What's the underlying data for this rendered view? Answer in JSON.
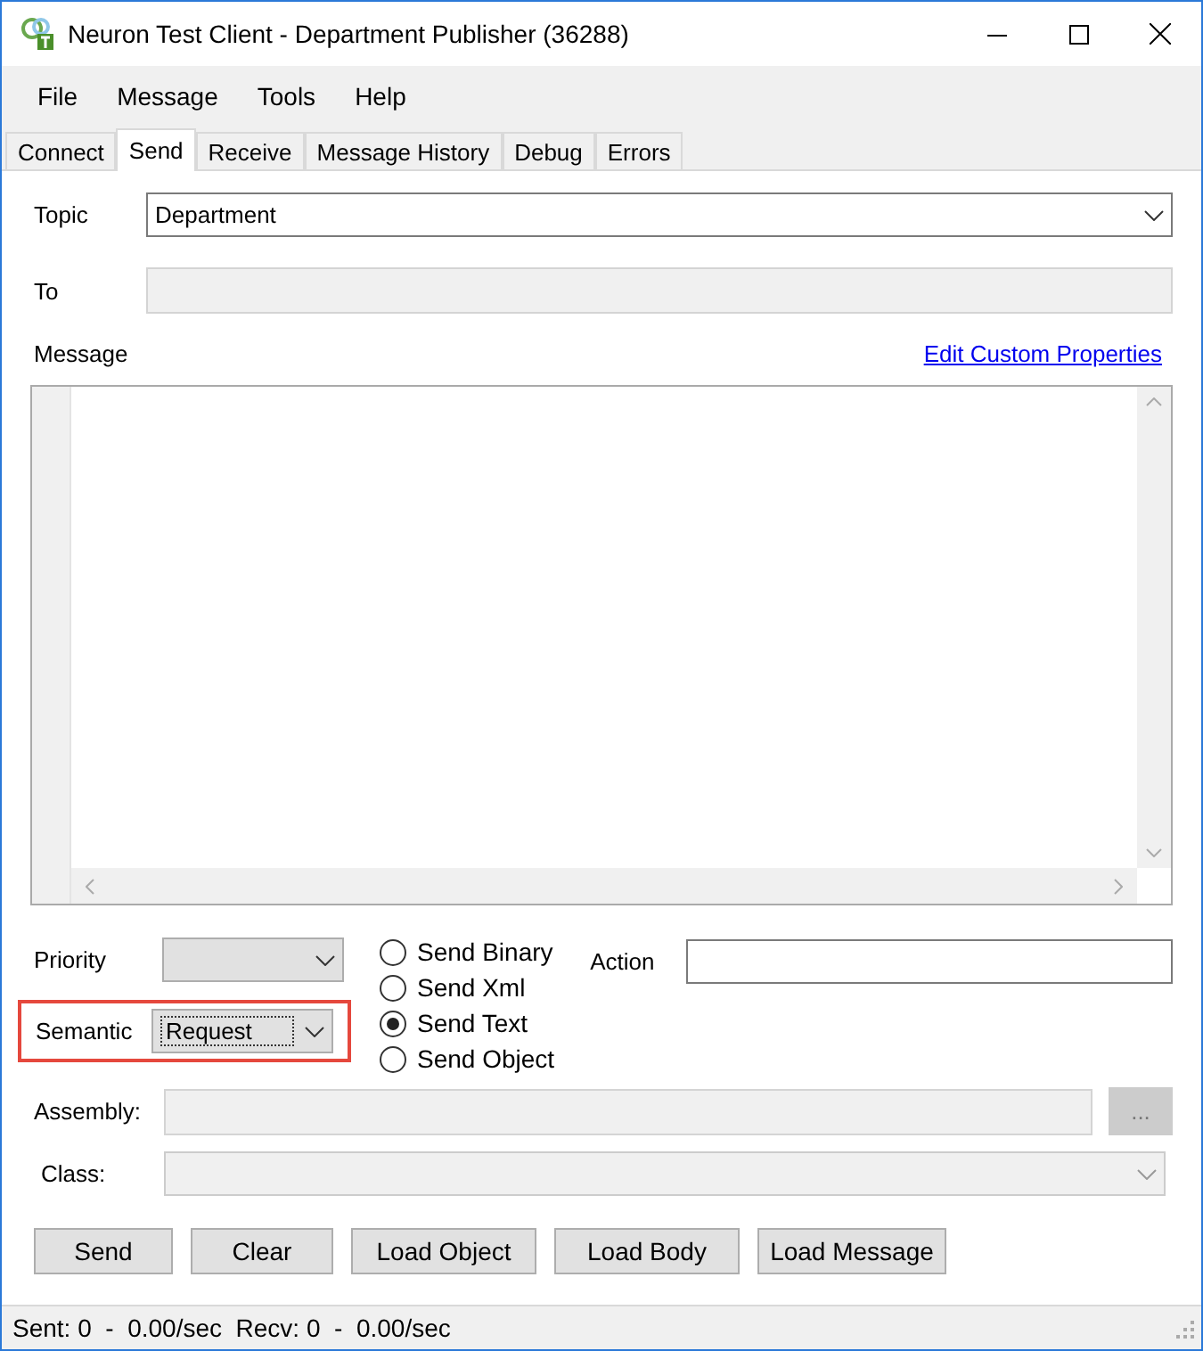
{
  "window": {
    "title": "Neuron Test Client - Department Publisher (36288)"
  },
  "menu": [
    "File",
    "Message",
    "Tools",
    "Help"
  ],
  "tabs": [
    {
      "label": "Connect",
      "selected": false
    },
    {
      "label": "Send",
      "selected": true
    },
    {
      "label": "Receive",
      "selected": false
    },
    {
      "label": "Message History",
      "selected": false
    },
    {
      "label": "Debug",
      "selected": false
    },
    {
      "label": "Errors",
      "selected": false
    }
  ],
  "topic": {
    "label": "Topic",
    "value": "Department"
  },
  "to": {
    "label": "To"
  },
  "message": {
    "label": "Message",
    "link": "Edit Custom Properties"
  },
  "priority": {
    "label": "Priority"
  },
  "semantic": {
    "label": "Semantic",
    "value": "Request",
    "highlighted": true
  },
  "send_modes": [
    {
      "label": "Send Binary",
      "selected": false
    },
    {
      "label": "Send Xml",
      "selected": false
    },
    {
      "label": "Send Text",
      "selected": true
    },
    {
      "label": "Send Object",
      "selected": false
    }
  ],
  "action": {
    "label": "Action"
  },
  "assembly": {
    "label": "Assembly:",
    "browse": "..."
  },
  "class": {
    "label": "Class:"
  },
  "buttons": [
    "Send",
    "Clear",
    "Load Object",
    "Load Body",
    "Load Message"
  ],
  "status_bar": "Sent: 0  -  0.00/sec  Recv: 0  -  0.00/sec"
}
